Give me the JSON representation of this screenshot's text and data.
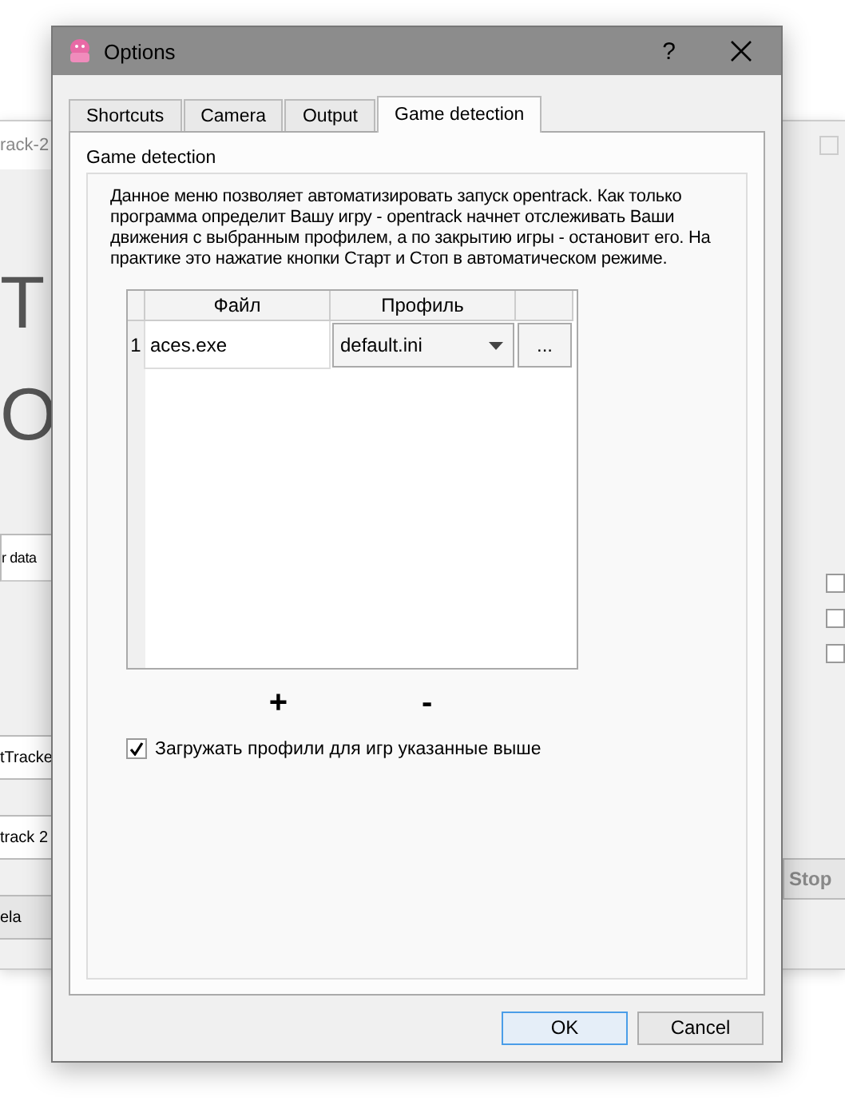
{
  "background_window": {
    "title": "rack-2",
    "large_texts": [
      "T",
      "O"
    ],
    "left_items": [
      {
        "kind": "tab",
        "text": "r data"
      },
      {
        "kind": "field",
        "text": "tTracke"
      },
      {
        "kind": "field",
        "text": "track 2"
      },
      {
        "kind": "button",
        "text": "ela"
      }
    ],
    "right_checkboxes": [
      {
        "checked": false
      },
      {
        "checked": false
      },
      {
        "checked": false
      }
    ],
    "right_button": "Stop"
  },
  "dialog": {
    "title": "Options",
    "help": "?",
    "tabs": [
      {
        "label": "Shortcuts",
        "selected": false
      },
      {
        "label": "Camera",
        "selected": false
      },
      {
        "label": "Output",
        "selected": false
      },
      {
        "label": "Game detection",
        "selected": true
      }
    ],
    "group_title": "Game detection",
    "description": "Данное меню позволяет автоматизировать запуск opentrack. Как только программа определит Вашу игру - opentrack начнет отслеживать Ваши движения с выбранным профилем, а по закрытию игры - остановит его. На практике это нажатие кнопки Старт и Стоп в автоматическом режиме.",
    "table": {
      "columns": [
        "Файл",
        "Профиль"
      ],
      "rows": [
        {
          "number": "1",
          "file": "aces.exe",
          "profile": "default.ini",
          "browse": "..."
        }
      ]
    },
    "add_button": "+",
    "remove_button": "-",
    "checkbox": {
      "label": "Загружать профили для игр указанные выше",
      "checked": true
    },
    "buttons": [
      {
        "label": "OK",
        "default": true
      },
      {
        "label": "Cancel",
        "default": false
      }
    ]
  }
}
